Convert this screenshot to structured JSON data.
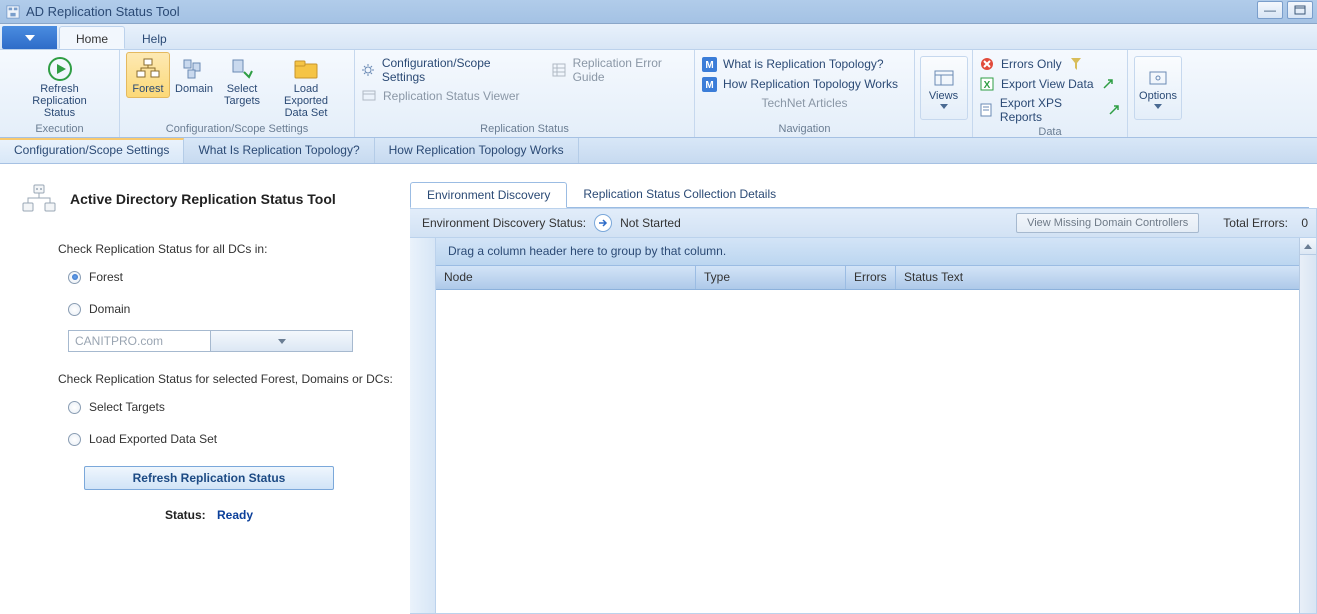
{
  "window": {
    "title": "AD Replication Status Tool"
  },
  "ribbon_tabs": {
    "file_menu": "▾",
    "home": "Home",
    "help": "Help"
  },
  "execution_group": {
    "refresh_line1": "Refresh Replication",
    "refresh_line2": "Status",
    "label": "Execution"
  },
  "config_group": {
    "forest": "Forest",
    "domain": "Domain",
    "select_targets_line1": "Select",
    "select_targets_line2": "Targets",
    "load_exported_line1": "Load Exported",
    "load_exported_line2": "Data Set",
    "label": "Configuration/Scope Settings"
  },
  "repstatus_group": {
    "config_scope": "Configuration/Scope Settings",
    "status_viewer": "Replication Status Viewer",
    "error_guide": "Replication Error Guide",
    "label": "Replication Status"
  },
  "nav_group": {
    "what_is": "What is Replication Topology?",
    "how_works": "How Replication Topology Works",
    "technet": "TechNet Articles",
    "label": "Navigation"
  },
  "views_group": {
    "views": "Views"
  },
  "data_group": {
    "errors_only": "Errors Only",
    "export_view": "Export View Data",
    "export_xps": "Export XPS Reports",
    "label": "Data"
  },
  "options_group": {
    "options": "Options"
  },
  "doctabs": {
    "t1": "Configuration/Scope Settings",
    "t2": "What Is Replication Topology?",
    "t3": "How Replication Topology Works"
  },
  "page": {
    "title": "Active Directory Replication Status Tool",
    "check_all_label": "Check Replication Status for all DCs in:",
    "radio_forest": "Forest",
    "radio_domain": "Domain",
    "combo_value": "CANITPRO.com",
    "check_selected_label": "Check Replication Status for selected Forest, Domains or DCs:",
    "radio_select_targets": "Select Targets",
    "radio_load_exported": "Load Exported Data Set",
    "refresh_button": "Refresh Replication Status",
    "status_label": "Status:",
    "status_value": "Ready"
  },
  "inner_tabs": {
    "t1": "Environment Discovery",
    "t2": "Replication Status Collection Details"
  },
  "statusbar": {
    "label": "Environment Discovery Status:",
    "value": "Not Started",
    "view_missing": "View Missing Domain Controllers",
    "total_errors_label": "Total Errors:",
    "total_errors_value": "0"
  },
  "grid": {
    "group_hint": "Drag a column header here to group by that column.",
    "cols": {
      "c1": "Node",
      "c2": "Type",
      "c3": "Errors",
      "c4": "Status Text"
    }
  }
}
